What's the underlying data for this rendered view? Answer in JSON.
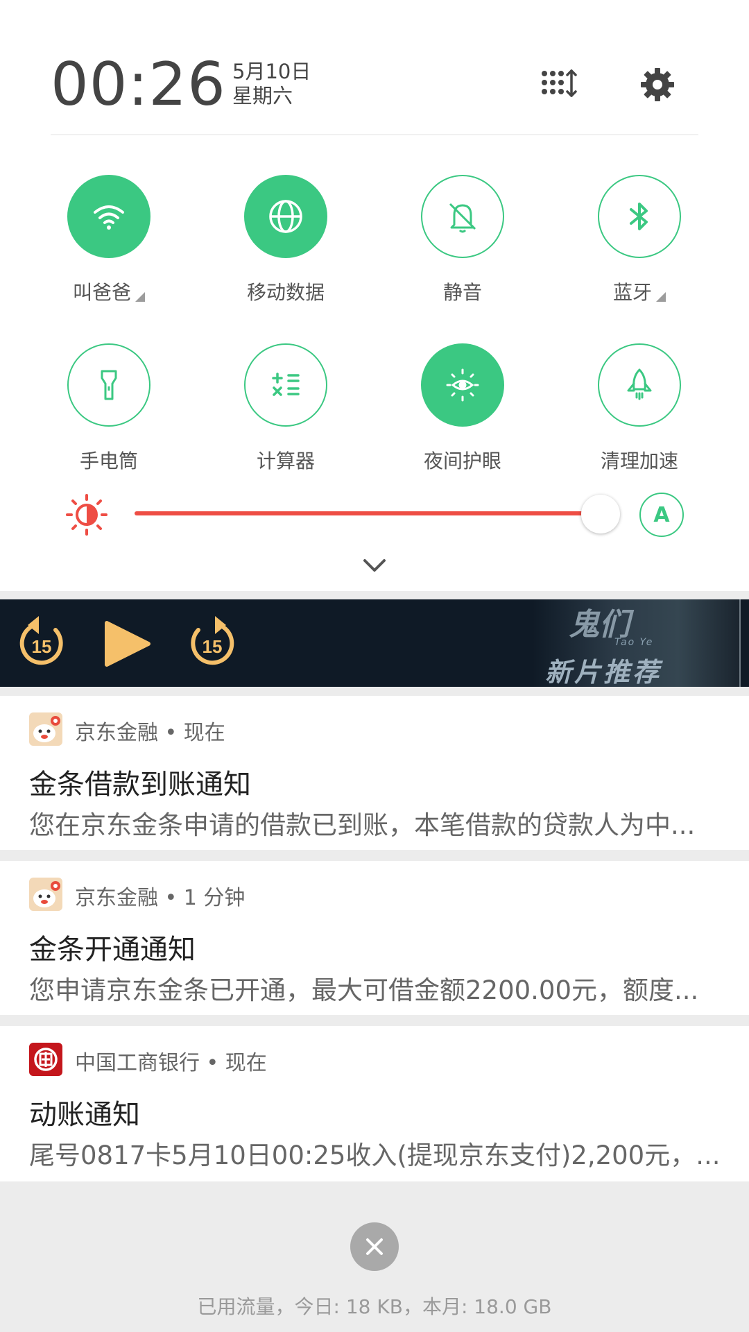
{
  "header": {
    "time": "00:26",
    "date": "5月10日",
    "weekday": "星期六",
    "icons": [
      "edit-tiles-icon",
      "gear-icon"
    ]
  },
  "tiles": [
    {
      "label": "叫爸爸",
      "icon": "wifi-icon",
      "on": true,
      "has_menu": true
    },
    {
      "label": "移动数据",
      "icon": "globe-icon",
      "on": true,
      "has_menu": false
    },
    {
      "label": "静音",
      "icon": "bell-icon",
      "on": false,
      "has_menu": false
    },
    {
      "label": "蓝牙",
      "icon": "bluetooth-icon",
      "on": false,
      "has_menu": true
    },
    {
      "label": "手电筒",
      "icon": "flashlight-icon",
      "on": false,
      "has_menu": false
    },
    {
      "label": "计算器",
      "icon": "calculator-icon",
      "on": false,
      "has_menu": false
    },
    {
      "label": "夜间护眼",
      "icon": "eye-care-icon",
      "on": true,
      "has_menu": false
    },
    {
      "label": "清理加速",
      "icon": "rocket-icon",
      "on": false,
      "has_menu": false
    }
  ],
  "brightness": {
    "level_percent": 94,
    "auto_label": "A",
    "track_color": "#ee4d44"
  },
  "media": {
    "controls": [
      "rewind-15-icon",
      "play-icon",
      "forward-15-icon"
    ],
    "rewind_seconds": "15",
    "forward_seconds": "15",
    "art_title": "鬼们",
    "art_subtitle": "Tao Ye",
    "art_tagline": "新片推荐"
  },
  "notifications": [
    {
      "app": "京东金融",
      "time": "现在",
      "title": "金条借款到账通知",
      "body": "您在京东金条申请的借款已到账，本笔借款的贷款人为中...",
      "icon": "jd-finance-icon"
    },
    {
      "app": "京东金融",
      "time": "1 分钟",
      "title": "金条开通通知",
      "body": "您申请京东金条已开通，最大可借金额2200.00元，额度...",
      "icon": "jd-finance-icon"
    },
    {
      "app": "中国工商银行",
      "time": "现在",
      "title": "动账通知",
      "body": "尾号0817卡5月10日00:25收入(提现京东支付)2,200元，...",
      "icon": "icbc-icon"
    }
  ],
  "footer": {
    "data_usage": "已用流量，今日: 18 KB，本月: 18.0 GB"
  },
  "colors": {
    "accent_green": "#3bc882",
    "brightness_red": "#ee4d44",
    "media_yellow": "#f5c06a"
  }
}
